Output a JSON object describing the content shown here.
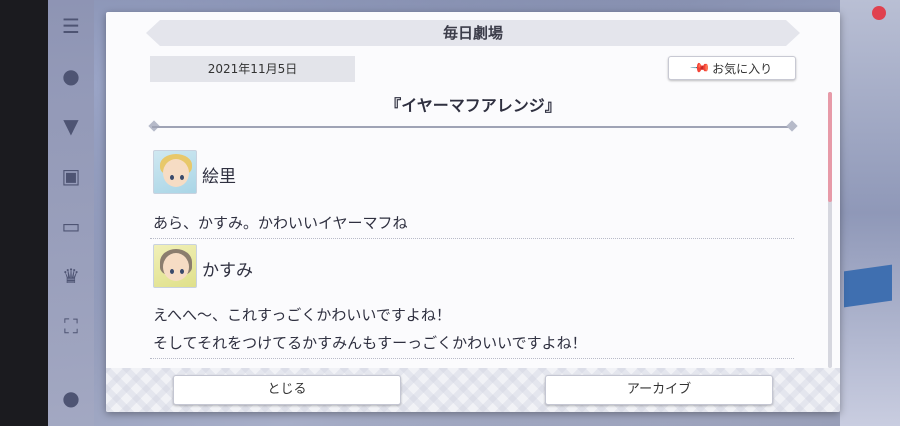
{
  "dialog": {
    "title": "毎日劇場",
    "date": "2021年11月5日",
    "favorite_label": "お気に入り",
    "story_title": "『イヤーマフアレンジ』"
  },
  "entries": [
    {
      "speaker": "絵里",
      "lines": [
        "あら、かすみ。かわいいイヤーマフね"
      ]
    },
    {
      "speaker": "かすみ",
      "lines": [
        "えへへ〜、これすっごくかわいいですよね！",
        "そしてそれをつけてるかすみんもすーっごくかわいいですよね！"
      ]
    }
  ],
  "footer": {
    "close_label": "とじる",
    "archive_label": "アーカイブ"
  },
  "colors": {
    "accent_scroll": "#e79aa8",
    "header_bg": "#e4e5ec",
    "dialog_bg": "#fbfbfd"
  },
  "icons": {
    "pin": "pin-icon",
    "side_menu": [
      "menu-icon",
      "chat-icon",
      "shirt-icon",
      "gift-icon",
      "screen-icon",
      "trophy-icon",
      "expand-icon",
      "person-icon"
    ]
  }
}
